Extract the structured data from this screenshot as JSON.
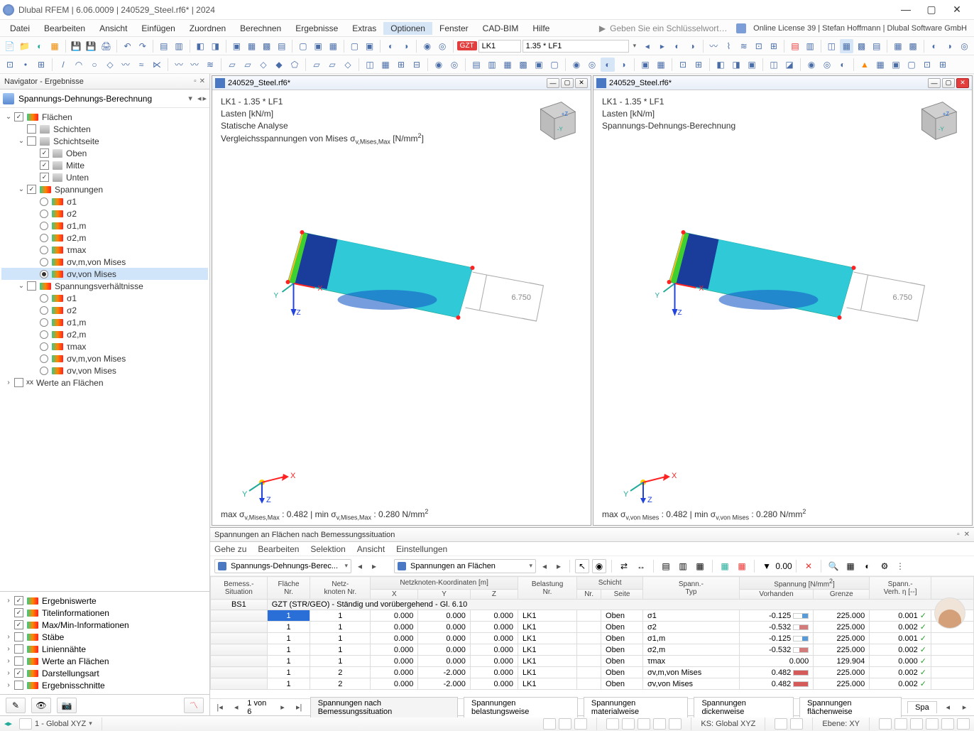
{
  "app": {
    "title": "Dlubal RFEM | 6.06.0009 | 240529_Steel.rf6* | 2024",
    "license": "Online License 39 | Stefan Hoffmann | Dlubal Software GmbH",
    "keyword_placeholder": "Geben Sie ein Schlüsselwort ein (Alt..."
  },
  "menu": [
    "Datei",
    "Bearbeiten",
    "Ansicht",
    "Einfügen",
    "Zuordnen",
    "Berechnen",
    "Ergebnisse",
    "Extras",
    "Optionen",
    "Fenster",
    "CAD-BIM",
    "Hilfe"
  ],
  "menu_highlight": "Optionen",
  "toolbar2": {
    "gzt": "GZT",
    "lk": "LK1",
    "combo": "1.35 * LF1"
  },
  "navigator": {
    "title": "Navigator - Ergebnisse",
    "selector": "Spannungs-Dehnungs-Berechnung",
    "tree": {
      "flaechen": "Flächen",
      "schichten": "Schichten",
      "schichtseite": "Schichtseite",
      "oben": "Oben",
      "mitte": "Mitte",
      "unten": "Unten",
      "spannungen": "Spannungen",
      "s1": "σ1",
      "s2": "σ2",
      "s1m": "σ1,m",
      "s2m": "σ2,m",
      "tmax": "τmax",
      "svm_mises": "σv,m,von Mises",
      "sv_mises": "σv,von Mises",
      "spannungsverh": "Spannungsverhältnisse",
      "werteanfl": "Werte an Flächen"
    },
    "lower": {
      "ergebniswerte": "Ergebniswerte",
      "titel": "Titelinformationen",
      "maxmin": "Max/Min-Informationen",
      "stabe": "Stäbe",
      "liniennahte": "Liniennähte",
      "werteanfl": "Werte an Flächen",
      "darstellungsart": "Darstellungsart",
      "ergebnisschnitte": "Ergebnisschnitte"
    }
  },
  "viewport": {
    "file": "240529_Steel.rf6*",
    "lk": "LK1 - 1.35 * LF1",
    "lasten": "Lasten [kN/m]",
    "statische": "Statische Analyse",
    "vergleich": "Vergleichsspannungen von Mises σv,Mises,Max [N/mm²]",
    "sdb": "Spannungs-Dehnungs-Berechnung",
    "dim": "6.750",
    "foot1": "max σv,Mises,Max : 0.482 | min σv,Mises,Max : 0.280 N/mm²",
    "foot2": "max σv,von Mises : 0.482 | min σv,von Mises : 0.280 N/mm²",
    "x": "X",
    "y": "Y",
    "z": "Z"
  },
  "table": {
    "title": "Spannungen an Flächen nach Bemessungssituation",
    "menu": [
      "Gehe zu",
      "Bearbeiten",
      "Selektion",
      "Ansicht",
      "Einstellungen"
    ],
    "combo1": "Spannungs-Dehnungs-Berec...",
    "combo2": "Spannungen an Flächen",
    "headers": {
      "situation": "Bemess.-\nSituation",
      "flaeche": "Fläche\nNr.",
      "netzknoten": "Netz-\nknoten Nr.",
      "koord": "Netzknoten-Koordinaten [m]",
      "x": "X",
      "y": "Y",
      "z": "Z",
      "belastung": "Belastung\nNr.",
      "schicht": "Schicht",
      "schicht_nr": "Nr.",
      "schicht_seite": "Seite",
      "spanntyp": "Spann.-\nTyp",
      "spannung": "Spannung [N/mm²]",
      "vorhanden": "Vorhanden",
      "grenze": "Grenze",
      "spannverh": "Spann.-\nVerh. η [--]"
    },
    "bs1": "BS1",
    "grouprow": "GZT (STR/GEO) - Ständig und vorübergehend - Gl. 6.10",
    "rows": [
      {
        "fl": "1",
        "nk": "1",
        "x": "0.000",
        "y": "0.000",
        "z": "0.000",
        "bn": "LK1",
        "ss": "Oben",
        "typ": "σ1",
        "vh": "-0.125",
        "bar": "b1",
        "gr": "225.000",
        "eta": "0.001"
      },
      {
        "fl": "1",
        "nk": "1",
        "x": "0.000",
        "y": "0.000",
        "z": "0.000",
        "bn": "LK1",
        "ss": "Oben",
        "typ": "σ2",
        "vh": "-0.532",
        "bar": "b2",
        "gr": "225.000",
        "eta": "0.002"
      },
      {
        "fl": "1",
        "nk": "1",
        "x": "0.000",
        "y": "0.000",
        "z": "0.000",
        "bn": "LK1",
        "ss": "Oben",
        "typ": "σ1,m",
        "vh": "-0.125",
        "bar": "b1",
        "gr": "225.000",
        "eta": "0.001"
      },
      {
        "fl": "1",
        "nk": "1",
        "x": "0.000",
        "y": "0.000",
        "z": "0.000",
        "bn": "LK1",
        "ss": "Oben",
        "typ": "σ2,m",
        "vh": "-0.532",
        "bar": "b2",
        "gr": "225.000",
        "eta": "0.002"
      },
      {
        "fl": "1",
        "nk": "1",
        "x": "0.000",
        "y": "0.000",
        "z": "0.000",
        "bn": "LK1",
        "ss": "Oben",
        "typ": "τmax",
        "vh": "0.000",
        "bar": "",
        "gr": "129.904",
        "eta": "0.000"
      },
      {
        "fl": "1",
        "nk": "2",
        "x": "0.000",
        "y": "-2.000",
        "z": "0.000",
        "bn": "LK1",
        "ss": "Oben",
        "typ": "σv,m,von Mises",
        "vh": "0.482",
        "bar": "b3",
        "gr": "225.000",
        "eta": "0.002"
      },
      {
        "fl": "1",
        "nk": "2",
        "x": "0.000",
        "y": "-2.000",
        "z": "0.000",
        "bn": "LK1",
        "ss": "Oben",
        "typ": "σv,von Mises",
        "vh": "0.482",
        "bar": "b3",
        "gr": "225.000",
        "eta": "0.002"
      }
    ],
    "pager": "1 von 6",
    "tabs": [
      "Spannungen nach Bemessungssituation",
      "Spannungen belastungsweise",
      "Spannungen materialweise",
      "Spannungen dickenweise",
      "Spannungen flächenweise",
      "Spa"
    ]
  },
  "status": {
    "coord": "1 - Global XYZ",
    "ks": "KS: Global XYZ",
    "ebene": "Ebene: XY"
  }
}
